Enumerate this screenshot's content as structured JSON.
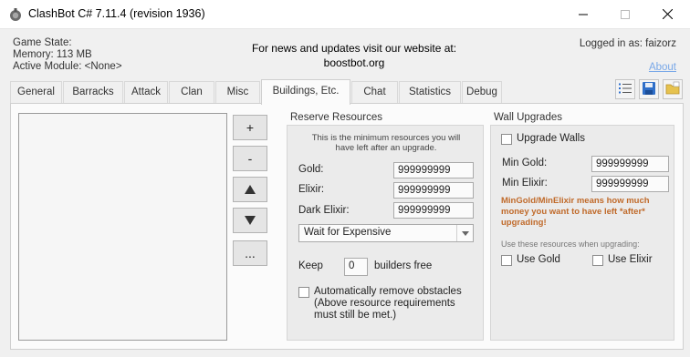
{
  "window": {
    "title": "ClashBot C# 7.11.4 (revision 1936)",
    "icon": "clashbot-app-icon"
  },
  "info": {
    "game_state": "Game State:",
    "memory": "Memory: 113 MB",
    "active_module": "Active Module: <None>",
    "news_line1": "For news and updates visit our website at:",
    "news_line2": "boostbot.org",
    "logged_in": "Logged in as: faizorz",
    "about": "About"
  },
  "tabs": [
    {
      "label": "General"
    },
    {
      "label": "Barracks"
    },
    {
      "label": "Attack"
    },
    {
      "label": "Clan"
    },
    {
      "label": "Misc"
    },
    {
      "label": "Buildings, Etc.",
      "active": true
    },
    {
      "label": "Chat"
    },
    {
      "label": "Statistics"
    },
    {
      "label": "Debug"
    }
  ],
  "toolbar_icons": [
    "list-icon",
    "save-icon",
    "open-folder-icon"
  ],
  "side_buttons": {
    "add": "+",
    "remove": "-",
    "up_icon": "arrow-up-icon",
    "down_icon": "arrow-down-icon",
    "more": "..."
  },
  "reserve": {
    "title": "Reserve Resources",
    "note_line1": "This is the minimum resources you will",
    "note_line2": "have left after an upgrade.",
    "gold_label": "Gold:",
    "gold_value": "999999999",
    "elixir_label": "Elixir:",
    "elixir_value": "999999999",
    "dark_label": "Dark Elixir:",
    "dark_value": "999999999",
    "wait_mode": "Wait for Expensive",
    "keep_label": "Keep",
    "keep_value": "0",
    "builders_label": "builders free",
    "obstacles_line1": "Automatically remove obstacles",
    "obstacles_line2": "(Above resource requirements",
    "obstacles_line3": "must still be met.)"
  },
  "walls": {
    "title": "Wall Upgrades",
    "upgrade_walls": "Upgrade Walls",
    "min_gold_label": "Min Gold:",
    "min_gold_value": "999999999",
    "min_elixir_label": "Min Elixir:",
    "min_elixir_value": "999999999",
    "warn_line1": "MinGold/MinElixir means how much",
    "warn_line2": "money you want to have left *after*",
    "warn_line3": "upgrading!",
    "use_note": "Use these resources when upgrading:",
    "use_gold": "Use Gold",
    "use_elixir": "Use Elixir"
  },
  "colors": {
    "link": "#79a8e8",
    "warning": "#c06a2a",
    "window_bg": "#f0f0f0"
  }
}
